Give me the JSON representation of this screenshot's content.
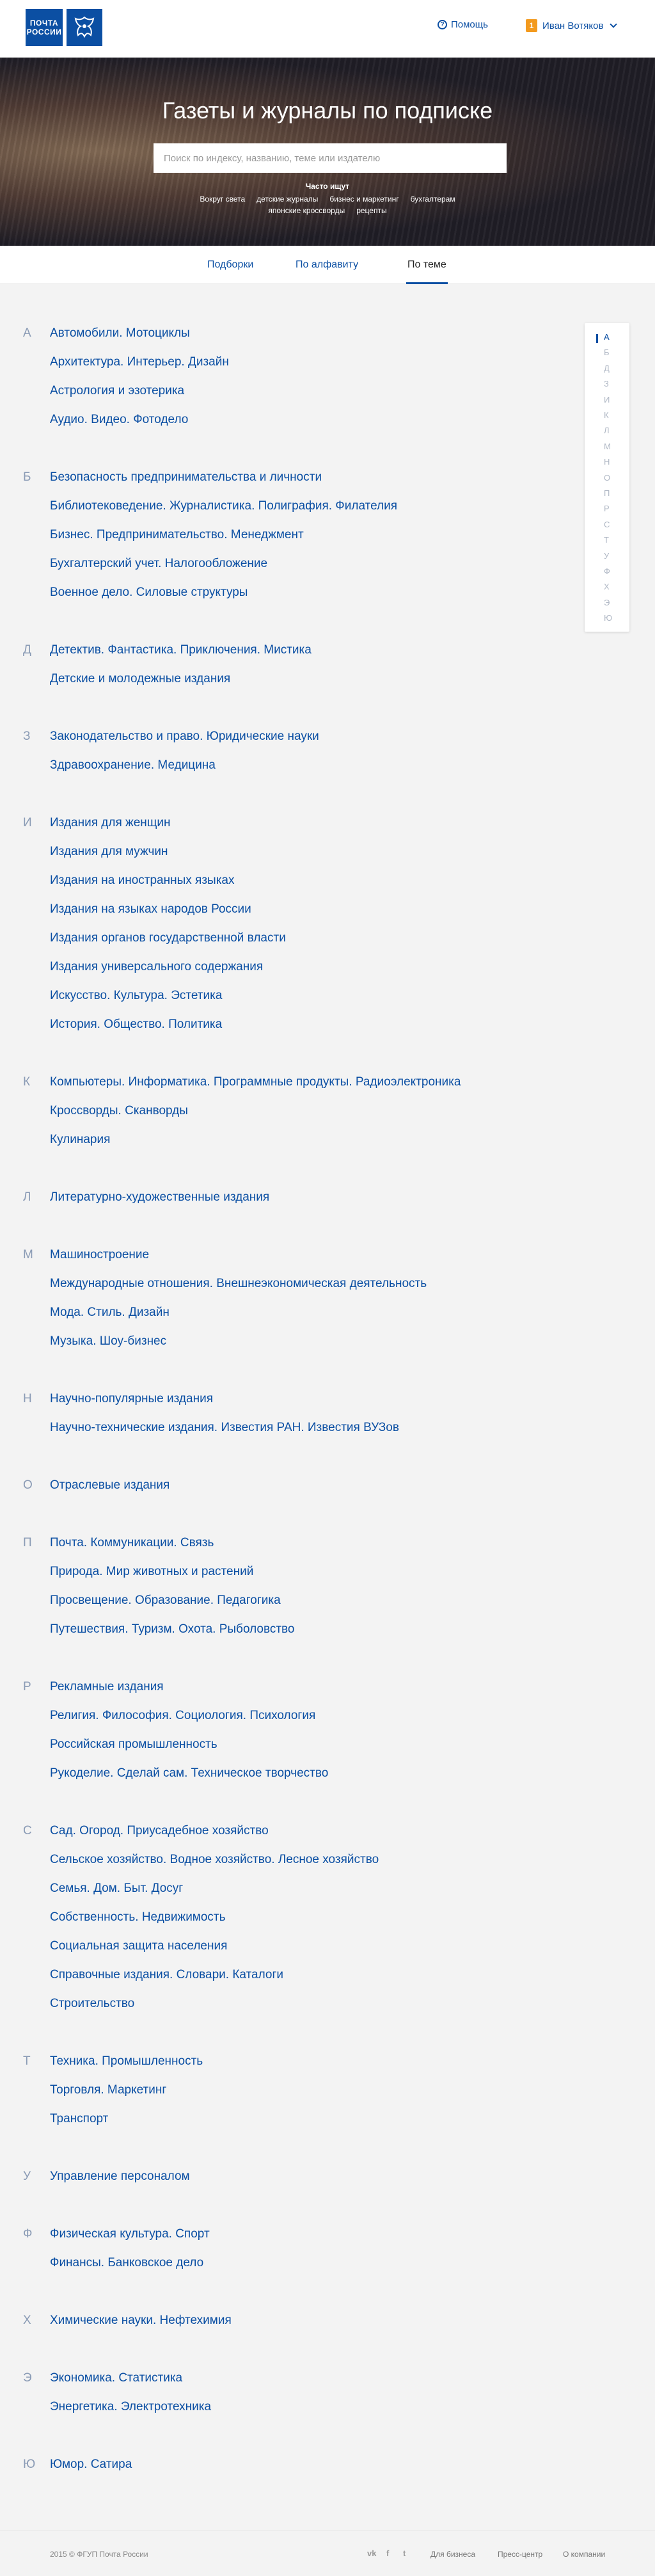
{
  "header": {
    "logo_line1": "ПОЧТА",
    "logo_line2": "РОССИИ",
    "help_label": "Помощь",
    "user_badge": "1",
    "user_name": "Иван Вотяков"
  },
  "hero": {
    "title": "Газеты и журналы по подписке",
    "search_placeholder": "Поиск по индексу, названию, теме или издателю",
    "popular_label": "Часто ищут",
    "popular_row1": [
      "Вокруг света",
      "детские журналы",
      "бизнес и маркетинг",
      "бухгалтерам"
    ],
    "popular_row2": [
      "японские кроссворды",
      "рецепты"
    ]
  },
  "tabs": [
    {
      "label": "Подборки"
    },
    {
      "label": "По алфавиту"
    },
    {
      "label": "По теме"
    }
  ],
  "groups": [
    {
      "letter": "А",
      "items": [
        "Автомобили. Мотоциклы",
        "Архитектура. Интерьер. Дизайн",
        "Астрология и эзотерика",
        "Аудио. Видео. Фотодело"
      ]
    },
    {
      "letter": "Б",
      "items": [
        "Безопасность предпринимательства и личности",
        "Библиотековедение. Журналистика. Полиграфия. Филателия",
        "Бизнес. Предпринимательство. Менеджмент",
        "Бухгалтерский учет. Налогообложение",
        "Военное дело. Силовые структуры"
      ]
    },
    {
      "letter": "Д",
      "items": [
        "Детектив. Фантастика. Приключения. Мистика",
        "Детские и молодежные издания"
      ]
    },
    {
      "letter": "З",
      "items": [
        "Законодательство и право. Юридические науки",
        "Здравоохранение. Медицина"
      ]
    },
    {
      "letter": "И",
      "items": [
        "Издания для женщин",
        "Издания для мужчин",
        "Издания на иностранных языках",
        "Издания на языках народов России",
        "Издания органов государственной власти",
        "Издания универсального содержания",
        "Искусство. Культура. Эстетика",
        "История. Общество. Политика"
      ]
    },
    {
      "letter": "К",
      "items": [
        "Компьютеры. Информатика. Программные продукты. Радиоэлектроника",
        "Кроссворды. Сканворды",
        "Кулинария"
      ]
    },
    {
      "letter": "Л",
      "items": [
        "Литературно-художественные издания"
      ]
    },
    {
      "letter": "М",
      "items": [
        "Машиностроение",
        "Международные отношения. Внешнеэкономическая деятельность",
        "Мода. Стиль. Дизайн",
        "Музыка. Шоу-бизнес"
      ]
    },
    {
      "letter": "Н",
      "items": [
        "Научно-популярные издания",
        "Научно-технические издания. Известия РАН. Известия ВУЗов"
      ]
    },
    {
      "letter": "О",
      "items": [
        "Отраслевые издания"
      ]
    },
    {
      "letter": "П",
      "items": [
        "Почта. Коммуникации. Связь",
        "Природа. Мир животных и растений",
        "Просвещение. Образование. Педагогика",
        "Путешествия. Туризм. Охота. Рыболовство"
      ]
    },
    {
      "letter": "Р",
      "items": [
        "Рекламные издания",
        "Религия. Философия. Социология. Психология",
        "Российская промышленность",
        "Рукоделие. Сделай сам. Техническое творчество"
      ]
    },
    {
      "letter": "С",
      "items": [
        "Сад. Огород. Приусадебное хозяйство",
        "Сельское хозяйство. Водное хозяйство. Лесное хозяйство",
        "Семья. Дом. Быт. Досуг",
        "Собственность. Недвижимость",
        "Социальная защита населения",
        "Справочные издания. Словари. Каталоги",
        "Строительство"
      ]
    },
    {
      "letter": "Т",
      "items": [
        "Техника. Промышленность",
        "Торговля. Маркетинг",
        "Транспорт"
      ]
    },
    {
      "letter": "У",
      "items": [
        "Управление персоналом"
      ]
    },
    {
      "letter": "Ф",
      "items": [
        "Физическая культура. Спорт",
        "Финансы. Банковское дело"
      ]
    },
    {
      "letter": "Х",
      "items": [
        "Химические науки. Нефтехимия"
      ]
    },
    {
      "letter": "Э",
      "items": [
        "Экономика. Статистика",
        "Энергетика. Электротехника"
      ]
    },
    {
      "letter": "Ю",
      "items": [
        "Юмор. Сатира"
      ]
    }
  ],
  "alphabet_index": [
    "А",
    "Б",
    "Д",
    "З",
    "И",
    "К",
    "Л",
    "М",
    "Н",
    "О",
    "П",
    "Р",
    "С",
    "Т",
    "У",
    "Ф",
    "Х",
    "Э",
    "Ю"
  ],
  "footer": {
    "copyright": "2015 © ФГУП Почта России",
    "social": [
      "vk",
      "f",
      "t"
    ],
    "links": [
      "Для бизнеса",
      "Пресс-центр",
      "О компании"
    ]
  },
  "colors": {
    "brand_blue": "#0b4fa3",
    "accent_orange": "#f39a1e",
    "letter_gray": "#8a9bb5"
  }
}
